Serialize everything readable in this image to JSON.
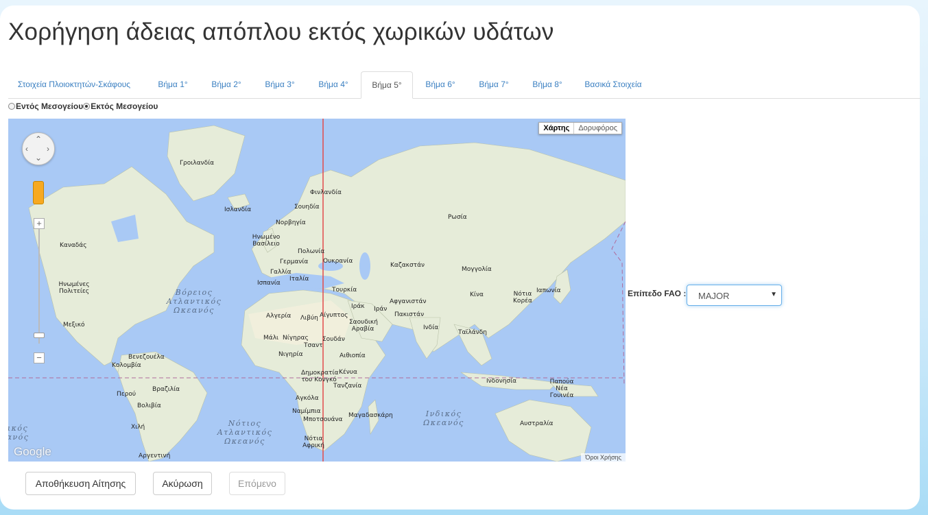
{
  "page": {
    "title": "Χορήγηση άδειας απόπλου εκτός χωρικών υδάτων"
  },
  "tabs": [
    {
      "label": "Στοιχεία Πλοιοκτητών-Σκάφους",
      "active": false
    },
    {
      "label": "Βήμα 1°",
      "active": false
    },
    {
      "label": "Βήμα 2°",
      "active": false
    },
    {
      "label": "Βήμα 3°",
      "active": false
    },
    {
      "label": "Βήμα 4°",
      "active": false
    },
    {
      "label": "Βήμα 5°",
      "active": true
    },
    {
      "label": "Βήμα 6°",
      "active": false
    },
    {
      "label": "Βήμα 7°",
      "active": false
    },
    {
      "label": "Βήμα 8°",
      "active": false
    },
    {
      "label": "Βασικά Στοιχεία",
      "active": false
    }
  ],
  "region_options": {
    "inside": {
      "label": "Εντός Μεσογείου",
      "checked": false
    },
    "outside": {
      "label": "Εκτός Μεσογείου",
      "checked": true
    }
  },
  "map": {
    "map_type_map": "Χάρτης",
    "map_type_satellite": "Δορυφόρος",
    "selected_map_type": "Χάρτης",
    "google_logo": "Google",
    "terms": "Όροι Χρήσης",
    "labels": {
      "greenland": "Γροιλανδία",
      "iceland": "Ισλανδία",
      "finland": "Φινλανδία",
      "sweden": "Σουηδία",
      "norway": "Νορβηγία",
      "uk": "Ηνωμένο Βασίλειο",
      "poland": "Πολωνία",
      "germany": "Γερμανία",
      "ukraine": "Ουκρανία",
      "france": "Γαλλία",
      "italy": "Ιταλία",
      "spain": "Ισπανία",
      "turkey": "Τουρκία",
      "russia": "Ρωσία",
      "kazakhstan": "Καζακστάν",
      "mongolia": "Μογγολία",
      "china": "Κίνα",
      "japan": "Ιαπωνία",
      "south_korea": "Νότια Κορέα",
      "canada": "Καναδάς",
      "usa": "Ηνωμένες Πολιτείες",
      "mexico": "Μεξικό",
      "venezuela": "Βενεζουέλα",
      "colombia": "Κολομβία",
      "peru": "Περού",
      "brazil": "Βραζιλία",
      "bolivia": "Βολιβία",
      "chile": "Χιλή",
      "argentina": "Αργεντινή",
      "algeria": "Αλγερία",
      "libya": "Λιβύη",
      "egypt": "Αίγυπτος",
      "iraq": "Ιράκ",
      "iran": "Ιράν",
      "afghanistan": "Αφγανιστάν",
      "pakistan": "Πακιστάν",
      "india": "Ινδία",
      "thailand": "Ταϊλάνδη",
      "saudi": "Σαουδική Αραβία",
      "mali": "Μάλι",
      "niger": "Νίγηρας",
      "chad": "Τσαντ",
      "sudan": "Σουδάν",
      "nigeria": "Νιγηρία",
      "ethiopia": "Αιθιοπία",
      "drc": "Δημοκρατία του Κονγκό",
      "kenya": "Κένυα",
      "tanzania": "Τανζανία",
      "angola": "Αγκόλα",
      "namibia": "Ναμίμπια",
      "botswana": "Μποτσουάνα",
      "madagascar": "Μαγαδασκάρη",
      "south_africa": "Νότια Αφρική",
      "indonesia": "Ινδονησία",
      "png": "Παπούα Νέα Γουινέα",
      "australia": "Αυστραλία",
      "n_atlantic": "Βόρειος Ατλαντικός Ωκεανός",
      "s_atlantic": "Νότιος Ατλαντικός Ωκεανός",
      "indian": "Ινδικός Ωκεανός",
      "pacific_partial": "ικός ανός"
    }
  },
  "fao": {
    "label": "Επίπεδο FAO :",
    "selected": "MAJOR"
  },
  "buttons": {
    "save": "Αποθήκευση Αίτησης",
    "cancel": "Ακύρωση",
    "next": "Επόμενο"
  }
}
